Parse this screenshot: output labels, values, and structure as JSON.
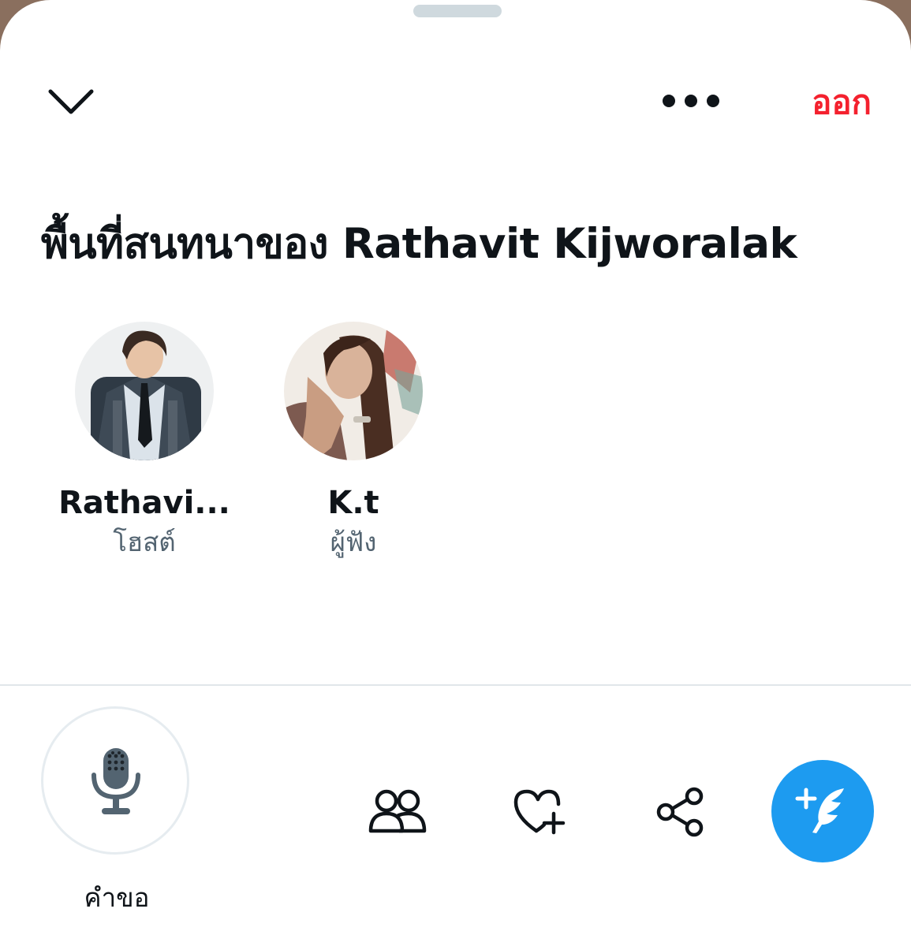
{
  "header": {
    "collapse_icon": "chevron-down-icon",
    "more_icon": "more-horizontal-icon",
    "leave_label": "ออก",
    "leave_color": "#f4212e"
  },
  "space": {
    "title": "พื้นที่สนทนาของ Rathavit Kijworalak"
  },
  "participants": [
    {
      "name": "Rathavi...",
      "role": "โฮสต์"
    },
    {
      "name": "K.t",
      "role": "ผู้ฟัง"
    }
  ],
  "footer": {
    "mic_icon": "microphone-icon",
    "mic_label": "คำขอ",
    "people_icon": "people-icon",
    "heart_icon": "heart-plus-icon",
    "share_icon": "share-icon",
    "compose_icon": "compose-feather-icon",
    "accent": "#1d9bf0"
  }
}
